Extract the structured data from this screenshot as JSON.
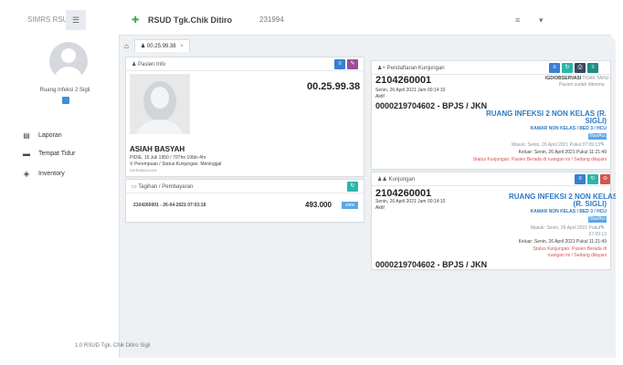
{
  "topbar": {
    "app_name": "SIMRS RSU",
    "hospital": "RSUD Tgk.Chik Ditiro",
    "user": "231994"
  },
  "sidebar": {
    "room": "Ruang Infeksi 2 Sigli",
    "items": [
      {
        "label": "Laporan",
        "icon": "file-icon"
      },
      {
        "label": "Tempat Tidur",
        "icon": "bed-icon"
      },
      {
        "label": "Inventory",
        "icon": "cubes-icon"
      }
    ]
  },
  "breadcrumb": {
    "tab_label": "00.25.99.38",
    "close": "×"
  },
  "pasien": {
    "header": "Pasien Info",
    "rm": "00.25.99.38",
    "name": "ASIAH BASYAH",
    "birth": "PIDIE, 15 Juli 1950 / 70Thn 10bln 4hr",
    "status": "Perempuan / Status Kunjungan. Meninggal",
    "small": "DIKEMBALIKAN"
  },
  "tagihan": {
    "header": "Tagihan / Pembayaran",
    "item": "2104260001 - 26-04-2021 07:03:18",
    "amount": "493.000",
    "btn": "view"
  },
  "pendaftaran": {
    "header": "Pendaftaran Kunjungan",
    "no": "2104260001",
    "date": "Senin, 26 April 2021 Jam 00:14:10",
    "aktif": "Aktif",
    "igd": "IGD/OBSERVASI",
    "tidak": "- TIDAK TAHU -",
    "diterima": "Pasien sudah diterima",
    "bpjs": "0000219704602 - BPJS / JKN",
    "ruang": "RUANG INFEKSI 2 NON KELAS (R. SIGLI)",
    "kamar": "KAMAR NON KELAS / BED 3 / HCU",
    "tag": "Tiba/Acc",
    "masuk": "Masuk: Senin, 26 April 2021 Pukul 07:09:13",
    "keluar": "Keluar: Senin, 26 April 2021 Pukul 11:21:49",
    "status": "Status Kunjungan. Pasien Berada di ruangan ini / Sedang dilayani"
  },
  "kunjungan": {
    "header": "Kunjungan",
    "no": "2104260001",
    "date": "Senin, 26 April 2021 Jam 00:14:10",
    "aktif": "Aktif",
    "ruang1": "RUANG INFEKSI 2 NON KELAS",
    "ruang2": "(R. SIGLI)",
    "kamar": "KAMAR NON KELAS / BED 3 / HCU",
    "tag": "Tiba/Acc",
    "masuk1": "Masuk: Senin, 26 April 2021 Pukul",
    "masuk2": "07:09:13",
    "keluar": "Keluar: Senin, 26 April 2021 Pukul 11:21:49",
    "status1": "Status Kunjungan. Pasien Berada di",
    "status2": "ruangan ini / Sedang dilayani",
    "bpjs": "0000219704602 - BPJS / JKN"
  },
  "footer": "1.0 RSUD Tgk. Chik Ditiro Sigli",
  "colors": {
    "blue": "#3a7fd0",
    "purple": "#9b4f96",
    "teal": "#2bb6a8",
    "red": "#d9534f",
    "dark": "#374a5c"
  }
}
